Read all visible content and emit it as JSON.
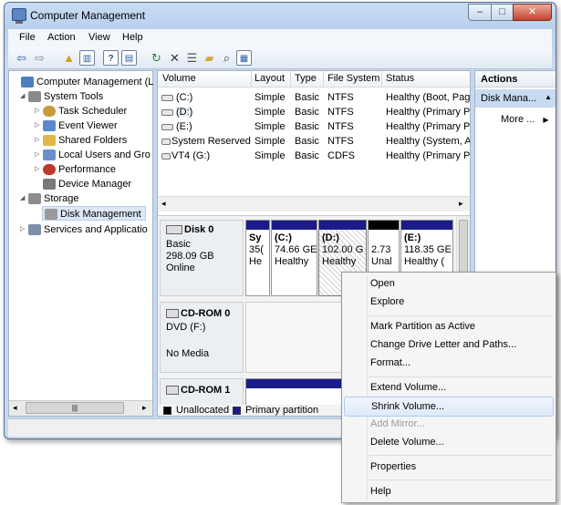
{
  "window": {
    "title": "Computer Management",
    "controls": {
      "minimize": "–",
      "maximize": "□",
      "close": "✕"
    }
  },
  "menubar": [
    "File",
    "Action",
    "View",
    "Help"
  ],
  "tree": {
    "items": [
      {
        "label": "Computer Management (L",
        "icon": "computer-icon",
        "color": "#4b7fc4"
      },
      {
        "label": "System Tools",
        "icon": "tools-icon",
        "color": "#8a8a8a"
      },
      {
        "label": "Task Scheduler",
        "icon": "clock-icon",
        "color": "#c79a3e"
      },
      {
        "label": "Event Viewer",
        "icon": "event-viewer-icon",
        "color": "#5a8acb"
      },
      {
        "label": "Shared Folders",
        "icon": "folder-icon",
        "color": "#e2b64a"
      },
      {
        "label": "Local Users and Gro",
        "icon": "users-icon",
        "color": "#6b8fc9"
      },
      {
        "label": "Performance",
        "icon": "performance-icon",
        "color": "#c0392b"
      },
      {
        "label": "Device Manager",
        "icon": "device-manager-icon",
        "color": "#7a7a7a"
      },
      {
        "label": "Storage",
        "icon": "storage-icon",
        "color": "#8c8c8c"
      },
      {
        "label": "Disk Management",
        "icon": "disk-icon",
        "color": "#9a9a9a"
      },
      {
        "label": "Services and Applicatio",
        "icon": "services-icon",
        "color": "#7a8fa8"
      }
    ],
    "scroll_left": "◂",
    "scroll_thumb": "|||",
    "scroll_right": "▸"
  },
  "volumes": {
    "headers": [
      "Volume",
      "Layout",
      "Type",
      "File System",
      "Status"
    ],
    "rows": [
      [
        "(C:)",
        "Simple",
        "Basic",
        "NTFS",
        "Healthy (Boot, Page"
      ],
      [
        "(D:)",
        "Simple",
        "Basic",
        "NTFS",
        "Healthy (Primary Pa"
      ],
      [
        "(E:)",
        "Simple",
        "Basic",
        "NTFS",
        "Healthy (Primary Pa"
      ],
      [
        "System Reserved",
        "Simple",
        "Basic",
        "NTFS",
        "Healthy (System, Ac"
      ],
      [
        "VT4 (G:)",
        "Simple",
        "Basic",
        "CDFS",
        "Healthy (Primary Pa"
      ]
    ],
    "scroll_left": "◂",
    "scroll_right": "▸"
  },
  "disks": {
    "disk0": {
      "name": "Disk 0",
      "type": "Basic",
      "size": "298.09 GB",
      "status": "Online",
      "partitions": [
        {
          "line1": "Sy",
          "line2": "35(",
          "line3": "He"
        },
        {
          "line1": "(C:)",
          "line2": "74.66 GE",
          "line3": "Healthy"
        },
        {
          "line1": "(D:)",
          "line2": "102.00 G",
          "line3": "Healthy"
        },
        {
          "line1": "",
          "line2": "2.73",
          "line3": "Unal"
        },
        {
          "line1": "(E:)",
          "line2": "118.35 GE",
          "line3": "Healthy ("
        }
      ]
    },
    "cdrom0": {
      "name": "CD-ROM 0",
      "drive": "DVD (F:)",
      "status": "No Media"
    },
    "cdrom1": {
      "name": "CD-ROM 1"
    },
    "legend": [
      "Unallocated",
      "Primary partition"
    ],
    "colors": {
      "unallocated": "#000000",
      "primary": "#1b1b8a"
    }
  },
  "actions": {
    "header": "Actions",
    "section": "Disk Mana...",
    "section_arrow": "▲",
    "more": "More ...",
    "more_arrow": "▶"
  },
  "context_menu": {
    "items": [
      "Open",
      "Explore",
      "Mark Partition as Active",
      "Change Drive Letter and Paths...",
      "Format...",
      "Extend Volume...",
      "Shrink Volume...",
      "Add Mirror...",
      "Delete Volume...",
      "Properties",
      "Help"
    ],
    "hovered": "Shrink Volume...",
    "disabled": "Add Mirror..."
  }
}
